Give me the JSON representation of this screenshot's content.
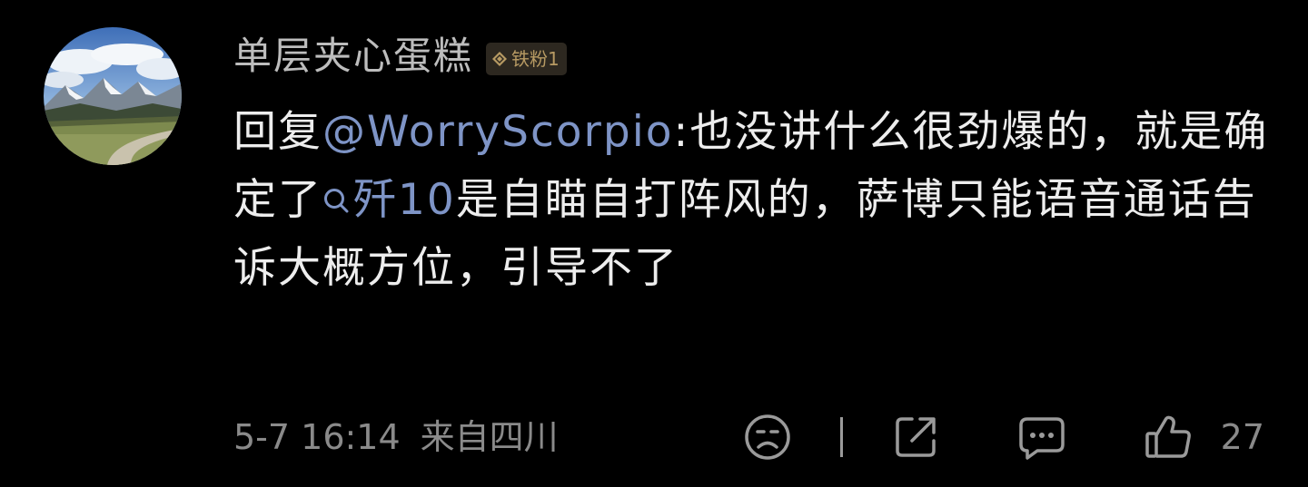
{
  "comment": {
    "author": {
      "name": "单层夹心蛋糕",
      "badge_label": "铁粉1"
    },
    "text_prefix": "回复",
    "mention": "@WorryScorpio",
    "text_part1": ":也没讲什么很劲爆的，就是确定了",
    "topic": "歼10",
    "text_part2": "是自瞄自打阵风的，萨博只能语音通话告诉大概方位，引导不了",
    "timestamp": "5-7 16:14",
    "location": "来自四川",
    "like_count": "27"
  },
  "icons": {
    "dislike": "frowning-face-icon",
    "share": "share-icon",
    "reply": "chat-bubble-icon",
    "like": "thumbs-up-icon",
    "badge": "diamond-icon",
    "topic": "search-icon"
  },
  "colors": {
    "background": "#000000",
    "link": "#7e94c6",
    "badge_bg": "#2d2820",
    "badge_text": "#b79a63"
  }
}
